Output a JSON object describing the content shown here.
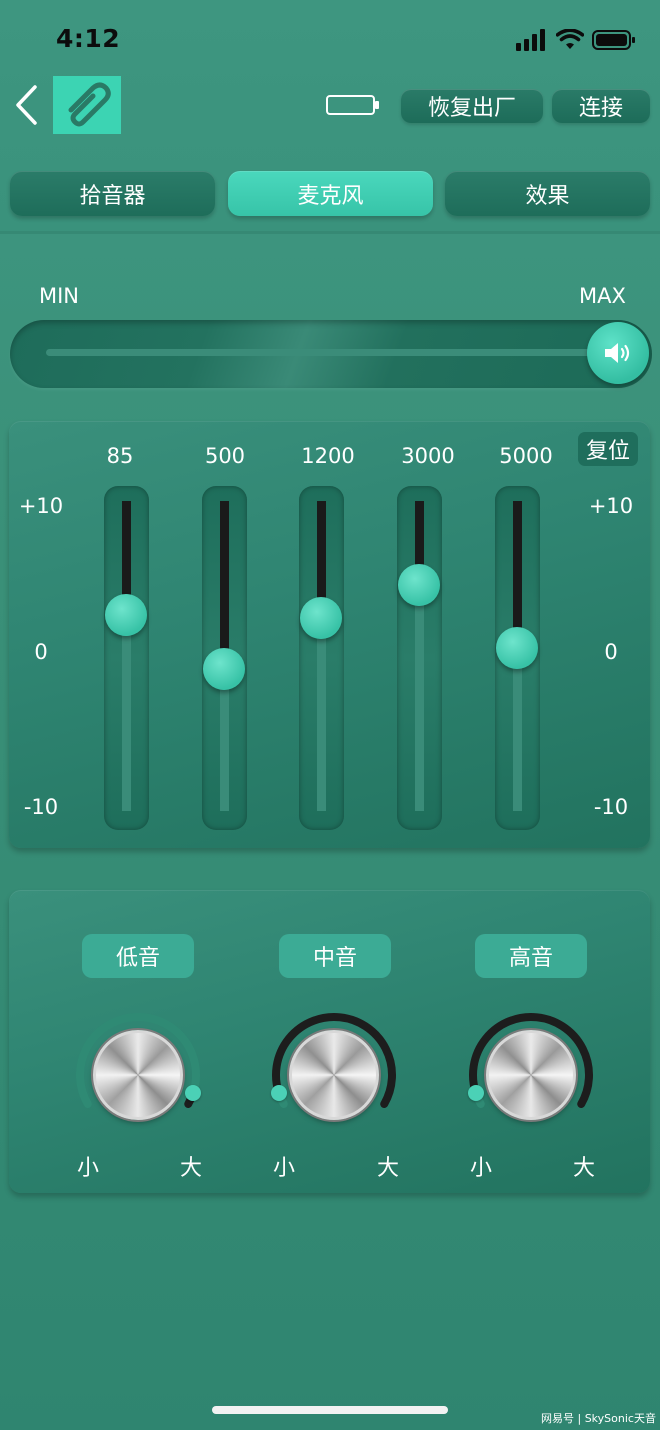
{
  "status_bar": {
    "time": "4:12"
  },
  "header": {
    "restore_label": "恢复出厂",
    "connect_label": "连接"
  },
  "tabs": [
    {
      "label": "拾音器",
      "active": false
    },
    {
      "label": "麦克风",
      "active": true
    },
    {
      "label": "效果",
      "active": false
    }
  ],
  "volume": {
    "min_label": "MIN",
    "max_label": "MAX",
    "level": 1.0
  },
  "eq": {
    "reset_label": "复位",
    "scale": {
      "top": "+10",
      "mid": "0",
      "bottom": "-10"
    },
    "bands": [
      {
        "freq": "85",
        "value": 2.4
      },
      {
        "freq": "500",
        "value": -1.2
      },
      {
        "freq": "1200",
        "value": 2.2
      },
      {
        "freq": "3000",
        "value": 4.4
      },
      {
        "freq": "5000",
        "value": 0.2
      }
    ]
  },
  "tone": {
    "small_label": "小",
    "big_label": "大",
    "knobs": [
      {
        "label": "低音",
        "level": 0.95
      },
      {
        "label": "中音",
        "level": 0.05
      },
      {
        "label": "高音",
        "level": 0.05
      }
    ]
  },
  "watermark": "网易号 | SkySonic天音",
  "colors": {
    "background": "#3a9078",
    "accent": "#3cd4b3",
    "dark_button": "#1f6e5c",
    "slider_fill": "#1a1a1a"
  }
}
